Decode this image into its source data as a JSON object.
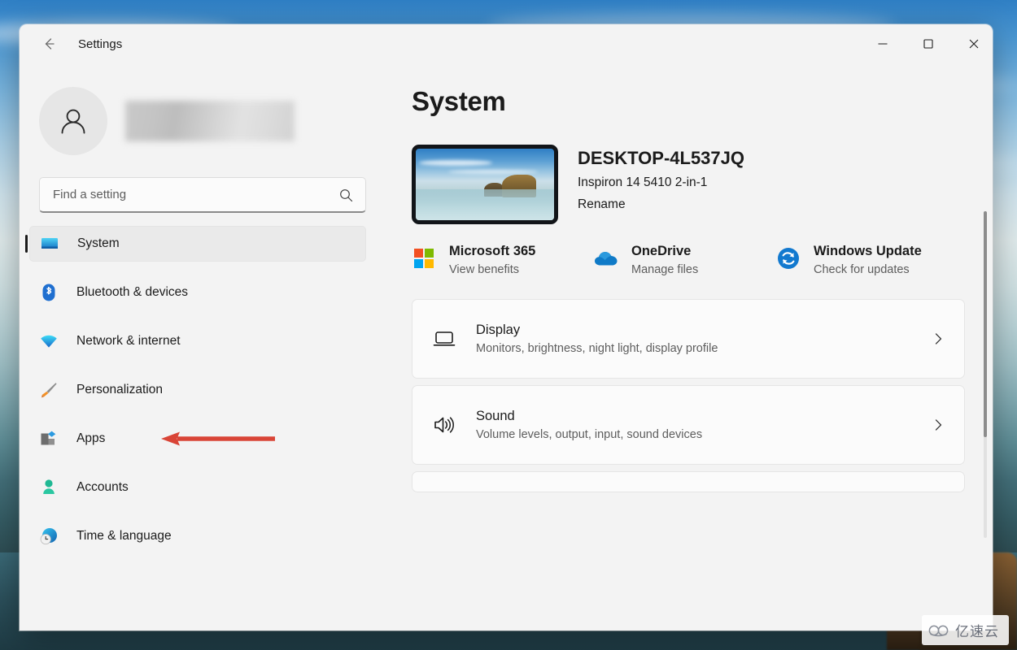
{
  "window": {
    "title": "Settings",
    "back_icon": "back-arrow-icon",
    "controls": {
      "minimize": "minimize-icon",
      "maximize": "maximize-icon",
      "close": "close-icon"
    }
  },
  "sidebar": {
    "account": {
      "avatar_icon": "person-icon",
      "name_redacted": ""
    },
    "search": {
      "placeholder": "Find a setting",
      "value": "",
      "icon": "search-icon"
    },
    "items": [
      {
        "label": "System",
        "icon": "monitor-icon",
        "selected": true
      },
      {
        "label": "Bluetooth & devices",
        "icon": "bluetooth-icon",
        "selected": false
      },
      {
        "label": "Network & internet",
        "icon": "wifi-icon",
        "selected": false
      },
      {
        "label": "Personalization",
        "icon": "paintbrush-icon",
        "selected": false
      },
      {
        "label": "Apps",
        "icon": "apps-blocks-icon",
        "selected": false
      },
      {
        "label": "Accounts",
        "icon": "person-badge-icon",
        "selected": false
      },
      {
        "label": "Time & language",
        "icon": "clock-globe-icon",
        "selected": false
      }
    ],
    "annotation": {
      "type": "red-arrow",
      "points_to": "Apps",
      "color": "#d94436"
    }
  },
  "main": {
    "title": "System",
    "device": {
      "thumbnail_icon": "device-wallpaper-thumbnail",
      "name": "DESKTOP-4L537JQ",
      "model": "Inspiron 14 5410 2-in-1",
      "rename_label": "Rename"
    },
    "quick_links": [
      {
        "title": "Microsoft 365",
        "subtitle": "View benefits",
        "icon": "microsoft-logo-icon"
      },
      {
        "title": "OneDrive",
        "subtitle": "Manage files",
        "icon": "onedrive-cloud-icon"
      },
      {
        "title": "Windows Update",
        "subtitle": "Check for updates",
        "icon": "windows-update-icon"
      }
    ],
    "cards": [
      {
        "title": "Display",
        "subtitle": "Monitors, brightness, night light, display profile",
        "icon": "display-monitor-icon",
        "chevron": "chevron-right-icon"
      },
      {
        "title": "Sound",
        "subtitle": "Volume levels, output, input, sound devices",
        "icon": "speaker-icon",
        "chevron": "chevron-right-icon"
      }
    ]
  },
  "watermark": {
    "text": "亿速云",
    "icon": "cloud-logo-icon"
  },
  "colors": {
    "window_bg": "#f3f3f3",
    "card_bg": "#fbfbfb",
    "text_primary": "#1b1b1b",
    "text_secondary": "#5d5d5d",
    "accent_bar": "#1a1a1a",
    "annotation_red": "#d94436"
  }
}
